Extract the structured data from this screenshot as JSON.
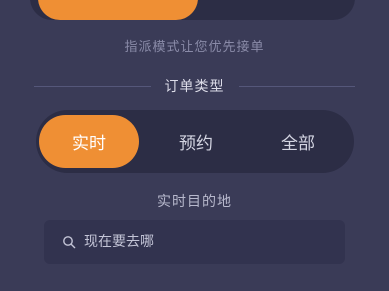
{
  "dispatch": {
    "hint": "指派模式让您优先接单"
  },
  "order_type": {
    "title": "订单类型",
    "options": [
      {
        "label": "实时",
        "selected": true
      },
      {
        "label": "预约",
        "selected": false
      },
      {
        "label": "全部",
        "selected": false
      }
    ]
  },
  "destination": {
    "label": "实时目的地",
    "placeholder": "现在要去哪",
    "icon": "search-icon"
  },
  "colors": {
    "background": "#3a3b57",
    "panel": "#2c2d45",
    "accent": "#ef8f34"
  }
}
